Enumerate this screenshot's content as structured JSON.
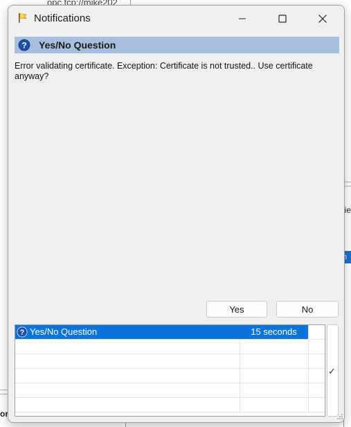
{
  "background": {
    "top_text": "opc.tcp://mike202",
    "right_fragment": "ie",
    "blue_fragment": "n",
    "left_fragment": "or"
  },
  "window": {
    "title": "Notifications",
    "icons": {
      "app": "app-icon",
      "minimize": "minimize-icon",
      "maximize": "maximize-icon",
      "close": "close-icon"
    }
  },
  "question": {
    "header": "Yes/No Question",
    "icon": "question-icon",
    "message": "Error validating certificate. Exception: Certificate is not trusted.. Use certificate anyway?"
  },
  "buttons": {
    "yes": "Yes",
    "no": "No"
  },
  "list": {
    "rows": [
      {
        "title": "Yes/No Question",
        "time": "15 seconds",
        "selected": true
      },
      {
        "title": "",
        "time": ""
      },
      {
        "title": "",
        "time": ""
      },
      {
        "title": "",
        "time": ""
      },
      {
        "title": "",
        "time": ""
      },
      {
        "title": "",
        "time": ""
      }
    ]
  },
  "side": {
    "check": "✓"
  },
  "colors": {
    "header_bg": "#a5bfdc",
    "selection": "#0a74da",
    "window_bg": "#f0f0f0"
  }
}
